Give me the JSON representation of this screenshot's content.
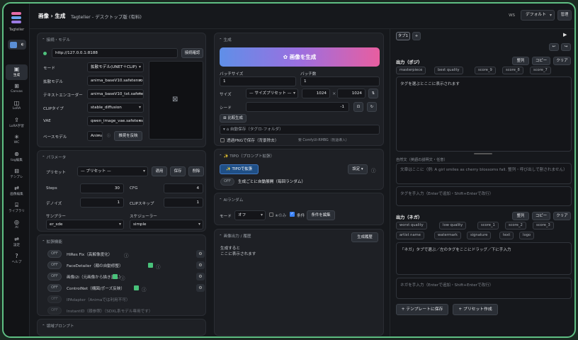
{
  "app": {
    "name": "Tagtelier",
    "page_title": "画像 › 生成",
    "subtitle": "Tagtelier - デスクトップ版 (有料)",
    "ws_label": "WS",
    "workspace": "デフォルト",
    "manage": "管理",
    "accent": "#5fbf83"
  },
  "nav": [
    {
      "icon": "generate-icon",
      "label": "生成",
      "active": true
    },
    {
      "icon": "canvas-icon",
      "label": "Canvas"
    },
    {
      "icon": "lora-icon",
      "label": "LoRA"
    },
    {
      "icon": "lora-training-icon",
      "label": "LoRA学習"
    },
    {
      "icon": "wc-icon",
      "label": "WC"
    },
    {
      "icon": "tag-icon",
      "label": "tag編集"
    },
    {
      "icon": "template-icon",
      "label": "テンプレ"
    },
    {
      "icon": "image-edit-icon",
      "label": "画像編集"
    },
    {
      "icon": "library-icon",
      "label": "ライブラリ"
    },
    {
      "icon": "ai-icon",
      "label": "AI"
    },
    {
      "icon": "settings-icon",
      "label": "設定"
    },
    {
      "icon": "help-icon",
      "label": "ヘルプ"
    }
  ],
  "connection": {
    "title": "接続・モデル",
    "url": "http://127.0.0.1:8188",
    "check_button": "接続確認",
    "rows": [
      {
        "label": "モード",
        "value": "拡散モデル(UNET＋CLIP)"
      },
      {
        "label": "拡散モデル",
        "value": "anima_baseV10.safetensors"
      },
      {
        "label": "テキストエンコーダー",
        "value": "anima_baseV10_txt.safetensors"
      },
      {
        "label": "CLIPタイプ",
        "value": "stable_diffusion"
      },
      {
        "label": "VAE",
        "value": "qwen_image_vae.safetensors"
      }
    ],
    "base_model_label": "ベースモデル",
    "base_model_value": "Anima",
    "apply_recommended": "推奨を反映"
  },
  "params": {
    "title": "パラメータ",
    "preset_label": "プリセット",
    "preset_value": "— プリセット —",
    "apply": "適用",
    "save": "保存",
    "delete": "削除",
    "steps_label": "Steps",
    "steps": "30",
    "cfg_label": "CFG",
    "cfg": "4",
    "denoise_label": "デノイズ",
    "denoise": "1",
    "clip_skip_label": "CLIPスキップ",
    "clip_skip": "1",
    "sampler_label": "サンプラー",
    "sampler": "er_sde",
    "scheduler_label": "スケジューラー",
    "scheduler": "simple"
  },
  "extensions": {
    "title": "拡張機能",
    "items": [
      {
        "state": "OFF",
        "label": "HiRes Fix（高解像度化）",
        "enabled": true
      },
      {
        "state": "OFF",
        "label": "FaceDetailer（顔の自動修整）",
        "enabled": true
      },
      {
        "state": "OFF",
        "label": "画像i2i（元画像から描き直し）",
        "enabled": true
      },
      {
        "state": "OFF",
        "label": "ControlNet（構図/ポーズ反映）",
        "enabled": true
      },
      {
        "state": "OFF",
        "label": "IPAdapter（Animaでは利用不可）",
        "enabled": false
      },
      {
        "state": "OFF",
        "label": "InstantID（顔参照）（SDXL系モデル専用です）",
        "enabled": false
      }
    ]
  },
  "region_prompt": {
    "title": "領域プロンプト"
  },
  "generate": {
    "title": "生成",
    "button": "画像を生成",
    "batch_size_label": "バッチサイズ",
    "batch_size": "1",
    "batch_count_label": "バッチ数",
    "batch_count": "1",
    "size_label": "サイズ",
    "size_preset": "— サイズプリセット —",
    "width": "1024",
    "height": "1024",
    "seed_label": "シード",
    "seed": "-1",
    "compare": "比較生成",
    "autosave": "自動保存（タグロ-フォルダ）",
    "transparent": "透過PNGで保存（背景除去）",
    "transparent_note": "要 ComfyUI-RMBG（別途導入）"
  },
  "tipo": {
    "title": "TIPO（プロンプト拡張）",
    "button": "TIPOで拡張",
    "settings": "設定",
    "state": "OFF",
    "auto_label": "生成ごとに自動展開（毎回ランダム）"
  },
  "ai_random": {
    "title": "AIランダム",
    "mode_label": "モード",
    "mode": "オフ",
    "only_label": "★のみ",
    "cond_label": "条件",
    "cond_button": "条件を編集"
  },
  "output": {
    "title": "画像出力 / 履歴",
    "history": "生成履歴",
    "placeholder_l1": "生成すると",
    "placeholder_l2": "ここに表示されます"
  },
  "right": {
    "tab": "タブ1",
    "add_tab": "+",
    "positive_title": "出力（ポジ）",
    "sort": "整列",
    "copy": "コピー",
    "clear": "クリア",
    "positive_chips": [
      "masterpiece",
      "best quality",
      "score_9",
      "score_8",
      "score_7"
    ],
    "positive_placeholder": "タグを選ぶとここに表示されます",
    "natural_label": "自然文（英語の説明文・任意）",
    "natural_placeholder": "文章はここに（例: A girl smiles as cherry blossoms fall. 整列・呼び出しで割されません）",
    "tag_input_placeholder": "タグを手入力（Enterで追加・Shift+Enterで改行）",
    "negative_title": "出力（ネガ）",
    "negative_chips": [
      "worst quality",
      "low quality",
      "score_1",
      "score_2",
      "score_3",
      "artist name",
      "watermark",
      "signature",
      "text",
      "logo"
    ],
    "negative_placeholder": "「ネガ」タブで選ぶ／左のタグをここにドラッグ／下に手入力",
    "neg_input_placeholder": "ネガを手入力（Enterで追加・Shift+Enterで改行）",
    "save_template": "+ テンプレートに保存",
    "make_preset": "+ プリセット作成"
  }
}
